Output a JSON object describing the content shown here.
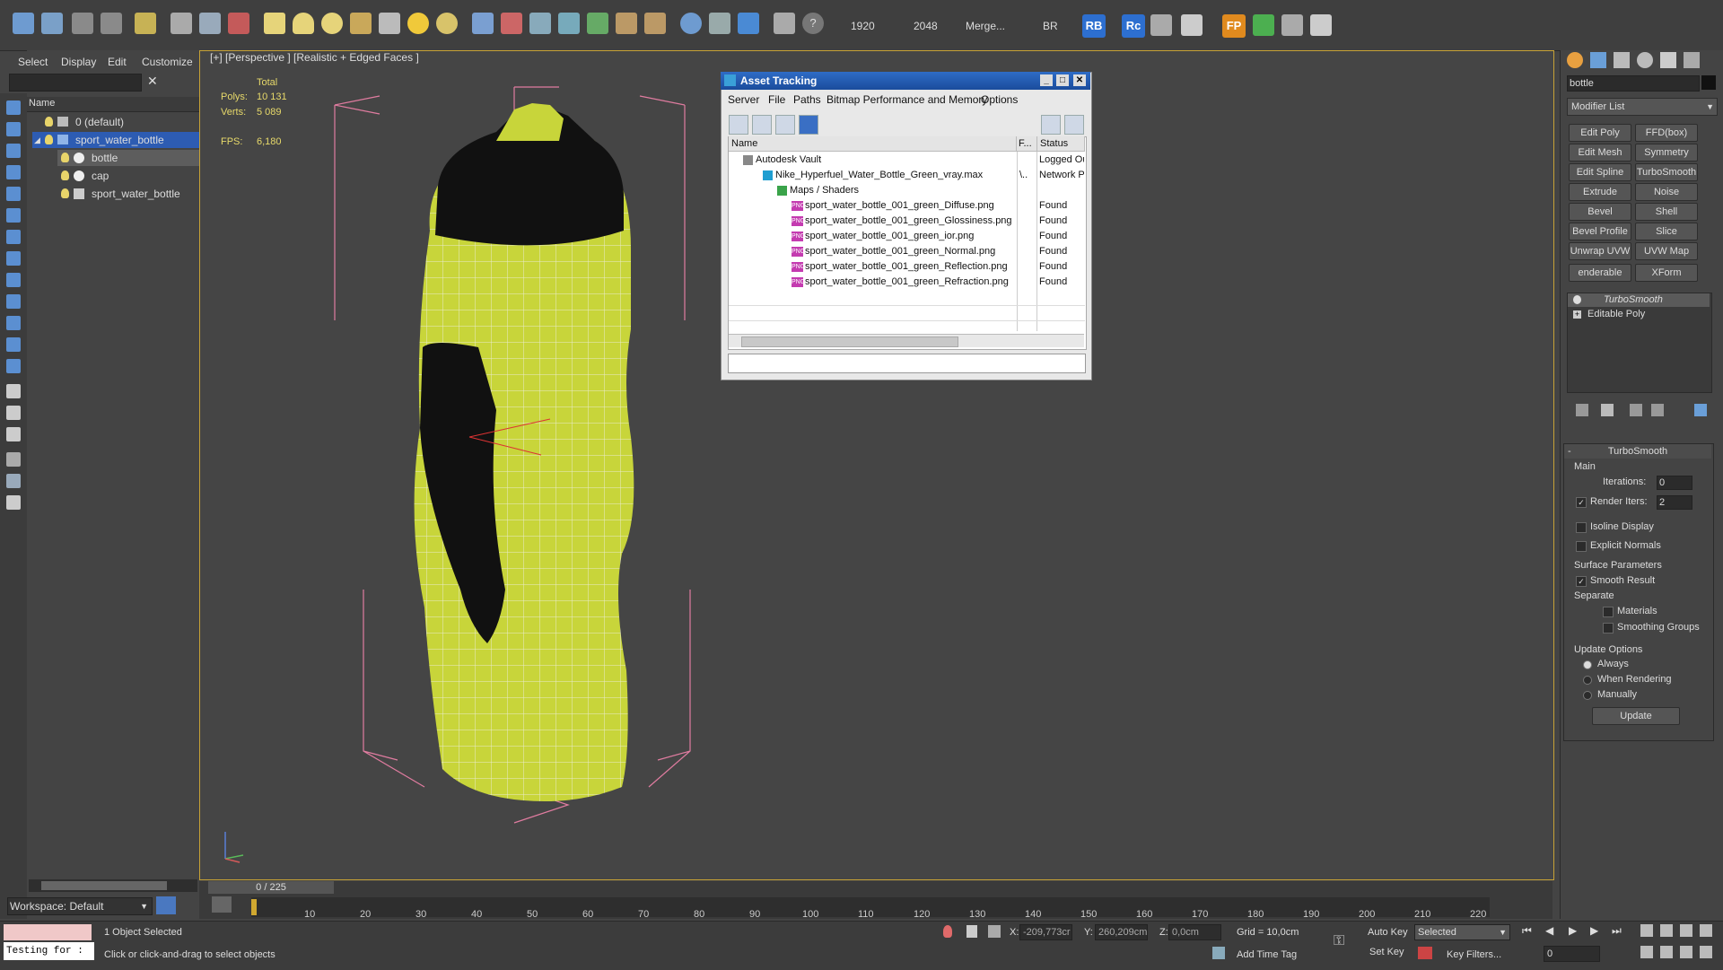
{
  "toolbar": {
    "res_width": "1920",
    "res_height": "2048",
    "merge_label": "Merge...",
    "br_label": "BR",
    "rb_badge": "RB",
    "rc_badge": "Rc",
    "fp_badge": "FP"
  },
  "explorer": {
    "menu": [
      "Select",
      "Display",
      "Edit",
      "Customize"
    ],
    "column_name": "Name",
    "layers": [
      {
        "label": "0 (default)"
      },
      {
        "label": "sport_water_bottle"
      },
      {
        "label": "bottle"
      },
      {
        "label": "cap"
      },
      {
        "label": "sport_water_bottle"
      }
    ],
    "workspace": "Workspace: Default"
  },
  "viewport": {
    "label": "[+] [Perspective ] [Realistic + Edged Faces ]",
    "stats": {
      "total_label": "Total",
      "polys_label": "Polys:",
      "polys_value": "10 131",
      "verts_label": "Verts:",
      "verts_value": "5 089",
      "fps_label": "FPS:",
      "fps_value": "6,180"
    }
  },
  "asset_tracking": {
    "title": "Asset Tracking",
    "menu": [
      "Server",
      "File",
      "Paths",
      "Bitmap Performance and Memory",
      "Options"
    ],
    "columns": [
      "Name",
      "F...",
      "Status"
    ],
    "rows": [
      {
        "name": "Autodesk Vault",
        "f": "",
        "status": "Logged Ou"
      },
      {
        "name": "Nike_Hyperfuel_Water_Bottle_Green_vray.max",
        "f": "\\..",
        "status": "Network P"
      },
      {
        "name": "Maps / Shaders",
        "f": "",
        "status": ""
      },
      {
        "name": "sport_water_bottle_001_green_Diffuse.png",
        "f": "",
        "status": "Found"
      },
      {
        "name": "sport_water_bottle_001_green_Glossiness.png",
        "f": "",
        "status": "Found"
      },
      {
        "name": "sport_water_bottle_001_green_ior.png",
        "f": "",
        "status": "Found"
      },
      {
        "name": "sport_water_bottle_001_green_Normal.png",
        "f": "",
        "status": "Found"
      },
      {
        "name": "sport_water_bottle_001_green_Reflection.png",
        "f": "",
        "status": "Found"
      },
      {
        "name": "sport_water_bottle_001_green_Refraction.png",
        "f": "",
        "status": "Found"
      }
    ]
  },
  "command_panel": {
    "object_name": "bottle",
    "modifier_list": "Modifier List",
    "modifier_buttons": [
      "Edit Poly",
      "FFD(box)",
      "Edit Mesh",
      "Symmetry",
      "Edit Spline",
      "TurboSmooth",
      "Extrude",
      "Noise",
      "Bevel",
      "Shell",
      "Bevel Profile",
      "Slice",
      "Unwrap UVW",
      "UVW Map",
      "enderable Splin",
      "XForm"
    ],
    "stack": [
      "TurboSmooth",
      "Editable Poly"
    ],
    "rollout_title": "TurboSmooth",
    "main_label": "Main",
    "iterations_label": "Iterations:",
    "iterations_value": "0",
    "render_iters_label": "Render Iters:",
    "render_iters_value": "2",
    "isoline_label": "Isoline Display",
    "explicit_normals_label": "Explicit Normals",
    "surface_params_label": "Surface Parameters",
    "smooth_result_label": "Smooth Result",
    "separate_label": "Separate",
    "materials_label": "Materials",
    "smoothing_groups_label": "Smoothing Groups",
    "update_options_label": "Update Options",
    "always_label": "Always",
    "when_rendering_label": "When Rendering",
    "manually_label": "Manually",
    "update_button": "Update"
  },
  "timeline": {
    "frame_counter": "0 / 225",
    "ticks": [
      "10",
      "20",
      "30",
      "40",
      "50",
      "60",
      "70",
      "80",
      "90",
      "100",
      "110",
      "120",
      "130",
      "140",
      "150",
      "160",
      "170",
      "180",
      "190",
      "200",
      "210",
      "220"
    ]
  },
  "status": {
    "script_listener": "Testing for :",
    "selection": "1 Object Selected",
    "prompt": "Click or click-and-drag to select objects",
    "x_label": "X:",
    "x_value": "-209,773cr",
    "y_label": "Y:",
    "y_value": "260,209cm",
    "z_label": "Z:",
    "z_value": "0,0cm",
    "grid": "Grid = 10,0cm",
    "add_time_tag": "Add Time Tag",
    "auto_key": "Auto Key",
    "set_key": "Set Key",
    "selected_dropdown": "Selected",
    "key_filters": "Key Filters...",
    "frame_field": "0"
  }
}
